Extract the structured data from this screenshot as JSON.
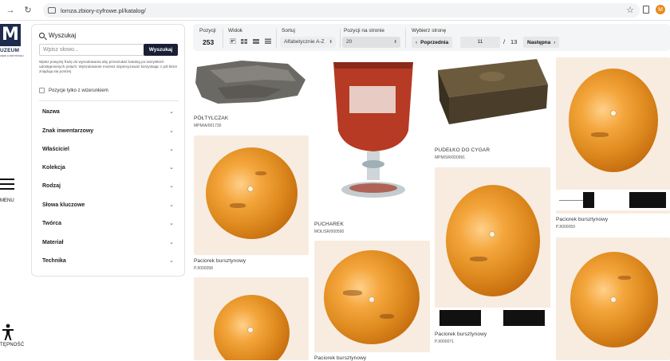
{
  "browser": {
    "url": "lomza.zbiory-cyfrowe.pl/katalog/",
    "avatar_letter": "M"
  },
  "rail": {
    "logo_text": "UZEUM",
    "logo_sub": "ZIEMI ŁOMŻYŃSKIEJ",
    "menu_label": "MENU",
    "access_label": "TĘPNOŚĆ"
  },
  "sidebar": {
    "search_title": "Wyszukaj",
    "search_placeholder": "Wpisz słowo...",
    "search_button": "Wyszukaj",
    "help_text": "Wpisz powyżej frazę do wyszukiwania aby przeszukać katalog po wszystkich udostępnionych polach. Wyszukiwanie możesz doprecyzować korzystając z pól które znajdują się poniżej",
    "only_images_label": "Pozycje tylko z wizerunkiem",
    "facets": [
      "Nazwa",
      "Znak inwentarzowy",
      "Właściciel",
      "Kolekcja",
      "Rodzaj",
      "Słowa kluczowe",
      "Twórca",
      "Materiał",
      "Technika"
    ]
  },
  "toolbar": {
    "positions_label": "Pozycji",
    "positions_count": "253",
    "view_label": "Widok",
    "sort_label": "Sortuj",
    "sort_value": "Alfabetycznie A-Z",
    "per_page_label": "Pozycji na stronie",
    "per_page_value": "20",
    "choose_page_label": "Wybierz stronę",
    "prev_label": "Poprzednia",
    "page_value": "11",
    "of_label": "/",
    "total_pages": "13",
    "next_label": "Następna"
  },
  "items": {
    "c1a": {
      "title": "PÓŁTYLCZAK",
      "inv": "MPM/A/001730"
    },
    "c1b": {
      "title": "Paciorek bursztynowy",
      "inv": "PJ/000058"
    },
    "c2a": {
      "title": "PUCHAREK",
      "inv": "MOŁ/SR/000590"
    },
    "c2b": {
      "title": "Paciorek bursztynowy",
      "inv": ""
    },
    "c3a": {
      "title": "PUDEŁKO DO CYGAR",
      "inv": "MPM/SR/000991"
    },
    "c3b": {
      "title": "Paciorek bursztynowy",
      "inv": "PJ/000071"
    },
    "c4a": {
      "title": "Paciorek bursztynowy",
      "inv": "PJ/000059"
    }
  },
  "colors": {
    "brand": "#1e2b4e",
    "button_dark": "#1a1f36",
    "toolbar_bg": "#f4f5f6",
    "amber": "#e08d21"
  }
}
